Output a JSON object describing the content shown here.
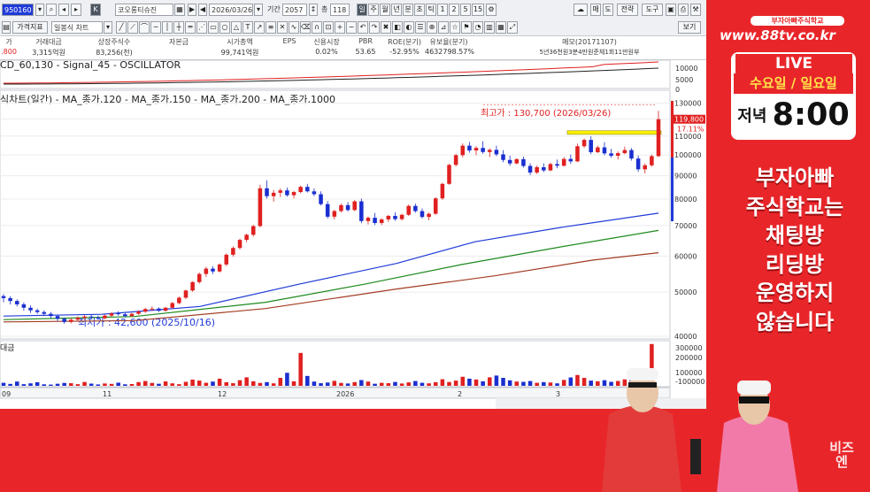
{
  "toolbar": {
    "code": "950160",
    "name": "코오롱티슈진",
    "date": "2026/03/26",
    "period_label": "기간",
    "period_value": "2057",
    "count_label": "총",
    "count_value": "118",
    "day_btn": "일",
    "week_btn": "주",
    "month_btn": "월",
    "year_btn": "년",
    "min_btn": "분",
    "tick_btn": "초",
    "tick2_btn": "틱",
    "nums": [
      "1",
      "2",
      "5",
      "15"
    ],
    "mae_btn": "매",
    "do_btn": "도",
    "chart_btn": "전략",
    "tools_btn": "도구",
    "price_index_btn": "가격지표",
    "chart_type": "일봉식 차트",
    "view_btn": "보기"
  },
  "info": {
    "columns": [
      {
        "h": "가",
        "v": ".800"
      },
      {
        "h": "거래대금",
        "v": "3,315억원"
      },
      {
        "h": "상장주식수",
        "v": "83,256(천)"
      },
      {
        "h": "자본금",
        "v": ""
      },
      {
        "h": "시가총액",
        "v": "99,741억원"
      },
      {
        "h": "EPS",
        "v": ""
      },
      {
        "h": "신용시장",
        "v": "0.02%"
      },
      {
        "h": "PBR",
        "v": "53.65"
      },
      {
        "h": "ROE(분기)",
        "v": "-52.95%"
      },
      {
        "h": "유보율(분기)",
        "v": "4632798.57%"
      },
      {
        "h": "메모(20171107)",
        "v": "5년36천원3분4만원준체1회11만원부"
      }
    ]
  },
  "macd_legend": "CD_60,130 - Signal_45 - OSCILLATOR",
  "ma_legend": "식차트(일간) - MA_종가,120 - MA_종가,150 - MA_종가,200 - MA_종가,1000",
  "price_high_note": "최고가 : 130,700 (2026/03/26)",
  "price_low_note": "최저가 : 42,600 (2025/10/16)",
  "volume_label": "대금",
  "current_price": "119,800",
  "current_pct": "17.11%",
  "colors": {
    "up": "#e02020",
    "down": "#1a2fd0",
    "ma120": "#1f3ad8",
    "ma150": "#1e8a1e",
    "ma200": "#a23b22"
  },
  "chart_data": {
    "type": "candlestick",
    "y_scale": "log",
    "price_axis": {
      "ticks": [
        130000,
        120000,
        110000,
        100000,
        90000,
        80000,
        70000,
        60000,
        50000,
        40000
      ],
      "labels": [
        "130000",
        "110000",
        "100000",
        "90000",
        "80000",
        "70000",
        "60000",
        "50000",
        "40000"
      ]
    },
    "macd_axis": {
      "labels": [
        "10000",
        "5000",
        "0"
      ]
    },
    "volume_axis": {
      "labels": [
        "300000",
        "200000",
        "100000",
        "-100000"
      ]
    },
    "x_labels": [
      "09",
      "11",
      "12",
      "2026",
      "2",
      "3"
    ],
    "candles": [
      [
        49000,
        49500,
        47500,
        48500
      ],
      [
        48500,
        49000,
        47000,
        47800
      ],
      [
        47800,
        48200,
        46500,
        47000
      ],
      [
        47000,
        47500,
        45500,
        46200
      ],
      [
        46200,
        46800,
        45000,
        45600
      ],
      [
        45600,
        46000,
        44800,
        45200
      ],
      [
        45200,
        45600,
        44300,
        44800
      ],
      [
        44800,
        45200,
        43800,
        44300
      ],
      [
        44300,
        44600,
        43200,
        43700
      ],
      [
        43700,
        44000,
        42600,
        43000
      ],
      [
        43000,
        43800,
        42700,
        43500
      ],
      [
        43500,
        44200,
        43100,
        43900
      ],
      [
        43900,
        44500,
        43500,
        44200
      ],
      [
        44200,
        44700,
        43700,
        44000
      ],
      [
        44000,
        44400,
        43500,
        43800
      ],
      [
        43800,
        44600,
        43600,
        44400
      ],
      [
        44400,
        45200,
        44100,
        44900
      ],
      [
        44900,
        45400,
        44400,
        44700
      ],
      [
        44700,
        45000,
        44000,
        44300
      ],
      [
        44300,
        45000,
        44100,
        44800
      ],
      [
        44800,
        45600,
        44600,
        45300
      ],
      [
        45300,
        46200,
        45000,
        45900
      ],
      [
        45900,
        46500,
        45500,
        46000
      ],
      [
        46000,
        46300,
        45200,
        45500
      ],
      [
        45500,
        46400,
        45300,
        46200
      ],
      [
        46200,
        47600,
        46000,
        47300
      ],
      [
        47300,
        48900,
        47000,
        48600
      ],
      [
        48600,
        50600,
        48300,
        50400
      ],
      [
        50400,
        52800,
        50100,
        52600
      ],
      [
        52600,
        55200,
        52200,
        54800
      ],
      [
        54800,
        56800,
        54000,
        56300
      ],
      [
        56300,
        57000,
        54800,
        55500
      ],
      [
        55500,
        57800,
        55200,
        57500
      ],
      [
        57500,
        60800,
        57000,
        60400
      ],
      [
        60400,
        63000,
        59800,
        62500
      ],
      [
        62500,
        65500,
        62000,
        65100
      ],
      [
        65100,
        67200,
        64400,
        66800
      ],
      [
        66800,
        70200,
        66200,
        69800
      ],
      [
        69800,
        86000,
        69400,
        84500
      ],
      [
        84500,
        88000,
        80200,
        81200
      ],
      [
        81200,
        83800,
        79000,
        82600
      ],
      [
        82600,
        84500,
        80800,
        83600
      ],
      [
        83600,
        84800,
        81000,
        81600
      ],
      [
        81600,
        83400,
        80300,
        82900
      ],
      [
        82900,
        85600,
        82400,
        85100
      ],
      [
        85100,
        86400,
        82700,
        83200
      ],
      [
        83200,
        84400,
        81200,
        82000
      ],
      [
        82000,
        83200,
        77500,
        78000
      ],
      [
        78000,
        79200,
        72500,
        73200
      ],
      [
        73200,
        75800,
        72200,
        75300
      ],
      [
        75300,
        78200,
        74800,
        77600
      ],
      [
        77600,
        78800,
        75100,
        75700
      ],
      [
        75700,
        79600,
        75300,
        79100
      ],
      [
        79100,
        80200,
        70800,
        71600
      ],
      [
        71600,
        73300,
        70400,
        72800
      ],
      [
        72800,
        74600,
        70200,
        70900
      ],
      [
        70900,
        72600,
        70200,
        72200
      ],
      [
        72200,
        73900,
        71300,
        73500
      ],
      [
        73500,
        74800,
        71700,
        72300
      ],
      [
        72300,
        74300,
        71800,
        73900
      ],
      [
        73900,
        77800,
        73500,
        77300
      ],
      [
        77300,
        78200,
        74700,
        75300
      ],
      [
        75300,
        76300,
        72500,
        73100
      ],
      [
        73100,
        74700,
        71900,
        74300
      ],
      [
        74300,
        80800,
        73900,
        80300
      ],
      [
        80300,
        86900,
        79700,
        86400
      ],
      [
        86400,
        95600,
        86000,
        95100
      ],
      [
        95100,
        100600,
        94300,
        99900
      ],
      [
        99900,
        106000,
        98800,
        104800
      ],
      [
        104800,
        106800,
        101200,
        102300
      ],
      [
        102300,
        104500,
        99900,
        103600
      ],
      [
        103600,
        107200,
        100600,
        101500
      ],
      [
        101500,
        103400,
        98900,
        102600
      ],
      [
        102600,
        104800,
        99400,
        100300
      ],
      [
        100300,
        102500,
        96400,
        97500
      ],
      [
        97500,
        99600,
        94700,
        95800
      ],
      [
        95800,
        98400,
        95400,
        97900
      ],
      [
        97900,
        99200,
        93800,
        94600
      ],
      [
        94600,
        95900,
        90300,
        91500
      ],
      [
        91500,
        94800,
        90800,
        94000
      ],
      [
        94000,
        95900,
        91700,
        92500
      ],
      [
        92500,
        96200,
        92100,
        95500
      ],
      [
        95500,
        97700,
        93500,
        94700
      ],
      [
        94700,
        98900,
        94300,
        98000
      ],
      [
        98000,
        100200,
        95600,
        96800
      ],
      [
        96800,
        105900,
        96400,
        104500
      ],
      [
        104500,
        108600,
        103700,
        107900
      ],
      [
        107900,
        109900,
        100400,
        101400
      ],
      [
        101400,
        104800,
        100900,
        103900
      ],
      [
        103900,
        106700,
        99900,
        100800
      ],
      [
        100800,
        103100,
        98600,
        99600
      ],
      [
        99600,
        101800,
        97700,
        100900
      ],
      [
        100900,
        104300,
        100400,
        102500
      ],
      [
        102500,
        103500,
        97200,
        98200
      ],
      [
        98200,
        99700,
        91800,
        93000
      ],
      [
        93000,
        95800,
        91100,
        94900
      ],
      [
        94900,
        100200,
        94300,
        99400
      ],
      [
        99400,
        125000,
        99000,
        119800
      ]
    ],
    "ma120": [
      [
        0,
        44300
      ],
      [
        0.15,
        44700
      ],
      [
        0.3,
        46500
      ],
      [
        0.45,
        52000
      ],
      [
        0.6,
        57800
      ],
      [
        0.72,
        64500
      ],
      [
        0.85,
        69300
      ],
      [
        1,
        74500
      ]
    ],
    "ma150": [
      [
        0,
        43500
      ],
      [
        0.2,
        44200
      ],
      [
        0.4,
        47500
      ],
      [
        0.55,
        52000
      ],
      [
        0.7,
        57500
      ],
      [
        0.85,
        62800
      ],
      [
        1,
        68300
      ]
    ],
    "ma200": [
      [
        0,
        43000
      ],
      [
        0.2,
        43300
      ],
      [
        0.4,
        46000
      ],
      [
        0.6,
        50800
      ],
      [
        0.75,
        54300
      ],
      [
        0.9,
        58800
      ],
      [
        1,
        61000
      ]
    ],
    "volume": [
      22000,
      14000,
      31000,
      12000,
      18000,
      26000,
      11000,
      9000,
      15000,
      21000,
      19000,
      12000,
      28000,
      16000,
      10000,
      17000,
      14000,
      23000,
      11000,
      13000,
      27000,
      35000,
      21000,
      15000,
      32000,
      18000,
      12000,
      29000,
      45000,
      38000,
      22000,
      31000,
      52000,
      26000,
      19000,
      41000,
      62000,
      33000,
      21000,
      27000,
      18000,
      58000,
      95000,
      33000,
      240000,
      72000,
      31000,
      19000,
      24000,
      36000,
      21000,
      17000,
      27000,
      42000,
      31000,
      15000,
      22000,
      19000,
      28000,
      17000,
      25000,
      35000,
      22000,
      18000,
      26000,
      48000,
      28000,
      38000,
      66000,
      52000,
      46000,
      33000,
      62000,
      75000,
      58000,
      40000,
      31000,
      29000,
      35000,
      22000,
      27000,
      24000,
      18000,
      43000,
      61000,
      79000,
      58000,
      38000,
      33000,
      41000,
      29000,
      35000,
      47000,
      52000,
      67000,
      88000,
      305000
    ]
  }
}
